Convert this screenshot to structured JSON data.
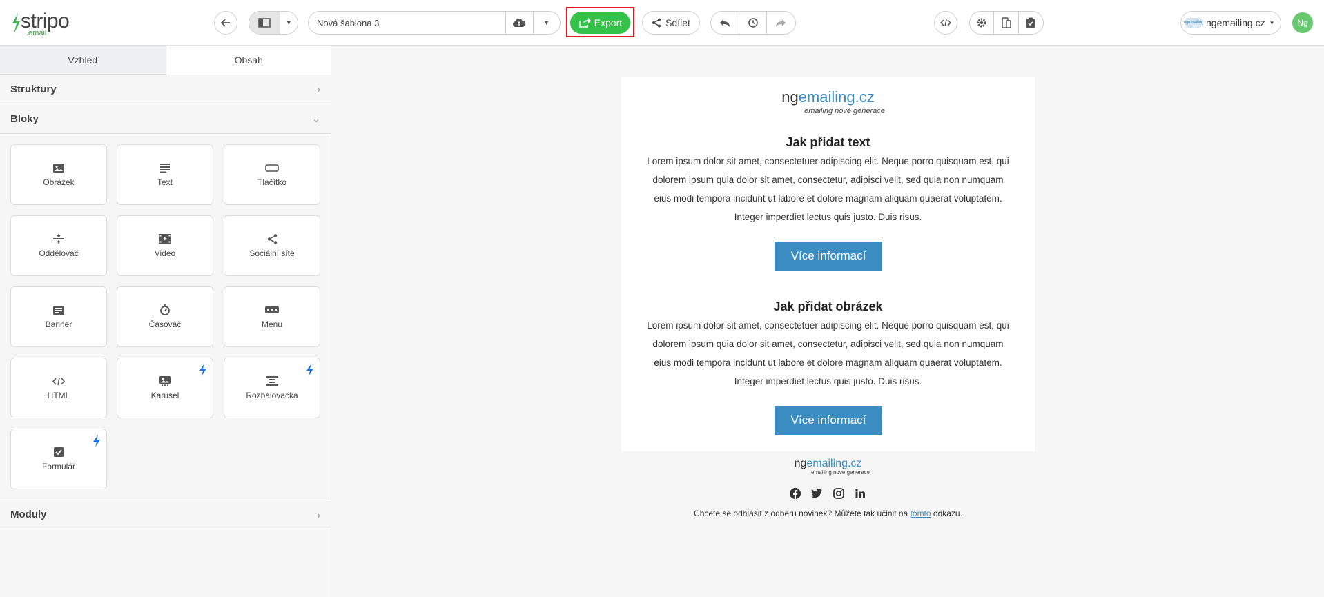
{
  "app": {
    "logo_text": "stripo",
    "logo_sub": ".email"
  },
  "toolbar": {
    "template_name": "Nová šablona 3",
    "export_label": "Export",
    "share_label": "Sdílet",
    "account_name": "ngemailing.cz",
    "account_logo_text": "ngemailing",
    "avatar_initials": "Ng"
  },
  "left_panel": {
    "tabs": [
      {
        "label": "Vzhled",
        "active": false
      },
      {
        "label": "Obsah",
        "active": true
      }
    ],
    "sections": {
      "structures": "Struktury",
      "blocks": "Bloky",
      "modules": "Moduly"
    },
    "blocks": [
      {
        "label": "Obrázek",
        "icon": "image-icon",
        "amp": false
      },
      {
        "label": "Text",
        "icon": "text-icon",
        "amp": false
      },
      {
        "label": "Tlačítko",
        "icon": "button-icon",
        "amp": false
      },
      {
        "label": "Oddělovač",
        "icon": "divider-icon",
        "amp": false
      },
      {
        "label": "Video",
        "icon": "video-icon",
        "amp": false
      },
      {
        "label": "Sociální sítě",
        "icon": "share-icon",
        "amp": false
      },
      {
        "label": "Banner",
        "icon": "banner-icon",
        "amp": false
      },
      {
        "label": "Časovač",
        "icon": "timer-icon",
        "amp": false
      },
      {
        "label": "Menu",
        "icon": "menu-icon",
        "amp": false
      },
      {
        "label": "HTML",
        "icon": "code-icon",
        "amp": false
      },
      {
        "label": "Karusel",
        "icon": "carousel-icon",
        "amp": true
      },
      {
        "label": "Rozbalovačka",
        "icon": "accordion-icon",
        "amp": true
      },
      {
        "label": "Formulář",
        "icon": "form-icon",
        "amp": true
      }
    ]
  },
  "email": {
    "brand_prefix": "ng",
    "brand_main": "emailing.cz",
    "brand_tagline": "emailing nové generace",
    "sections": [
      {
        "heading": "Jak přidat text",
        "body": "Lorem ipsum dolor sit amet, consectetuer adipiscing elit. Neque porro quisquam est, qui dolorem ipsum quia dolor sit amet, consectetur, adipisci velit, sed quia non numquam eius modi tempora incidunt ut labore et dolore magnam aliquam quaerat voluptatem. Integer imperdiet lectus quis justo. Duis risus.",
        "button": "Více informací"
      },
      {
        "heading": "Jak přidat obrázek",
        "body": "Lorem ipsum dolor sit amet, consectetuer adipiscing elit. Neque porro quisquam est, qui dolorem ipsum quia dolor sit amet, consectetur, adipisci velit, sed quia non numquam eius modi tempora incidunt ut labore et dolore magnam aliquam quaerat voluptatem. Integer imperdiet lectus quis justo. Duis risus.",
        "button": "Více informací"
      }
    ],
    "footer": {
      "unsubscribe_text": "Chcete se odhlásit z odběru novinek? Můžete tak učinit na ",
      "unsubscribe_link": "tomto",
      "unsubscribe_suffix": " odkazu.",
      "socials": [
        "facebook-icon",
        "twitter-icon",
        "instagram-icon",
        "linkedin-icon"
      ]
    }
  },
  "colors": {
    "export_green": "#34c24a",
    "highlight_red": "#e01b24",
    "brand_blue": "#3b8dc2",
    "avatar_green": "#67c86f"
  }
}
